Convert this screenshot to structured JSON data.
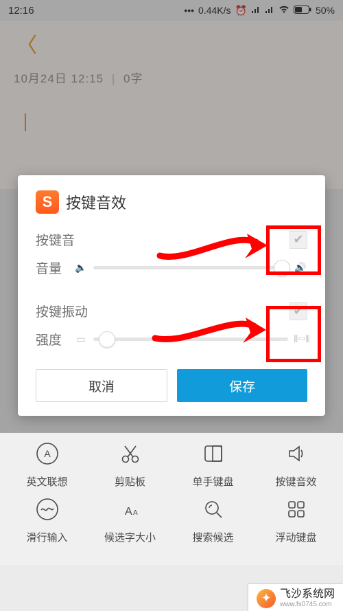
{
  "status": {
    "time": "12:16",
    "speed": "0.44K/s",
    "battery": "50%"
  },
  "note": {
    "meta": "10月24日  12:15",
    "count": "0字"
  },
  "dialog": {
    "logo_letter": "S",
    "title": "按键音效",
    "sound_label": "按键音",
    "volume_label": "音量",
    "vibrate_label": "按键振动",
    "intensity_label": "强度",
    "volume_value_pct": 97,
    "intensity_value_pct": 7,
    "sound_checked": true,
    "vibrate_checked": true,
    "cancel": "取消",
    "save": "保存"
  },
  "grid": {
    "row1": [
      {
        "label": "英文联想",
        "icon": "circle-a"
      },
      {
        "label": "剪贴板",
        "icon": "scissors"
      },
      {
        "label": "单手键盘",
        "icon": "one-hand"
      },
      {
        "label": "按键音效",
        "icon": "speaker"
      }
    ],
    "row2": [
      {
        "label": "滑行输入",
        "icon": "wave-circle"
      },
      {
        "label": "候选字大小",
        "icon": "font-size"
      },
      {
        "label": "搜索候选",
        "icon": "search"
      },
      {
        "label": "浮动键盘",
        "icon": "grid4"
      }
    ]
  },
  "watermark": {
    "title": "飞沙系统网",
    "sub": "www.fs0745.com"
  }
}
